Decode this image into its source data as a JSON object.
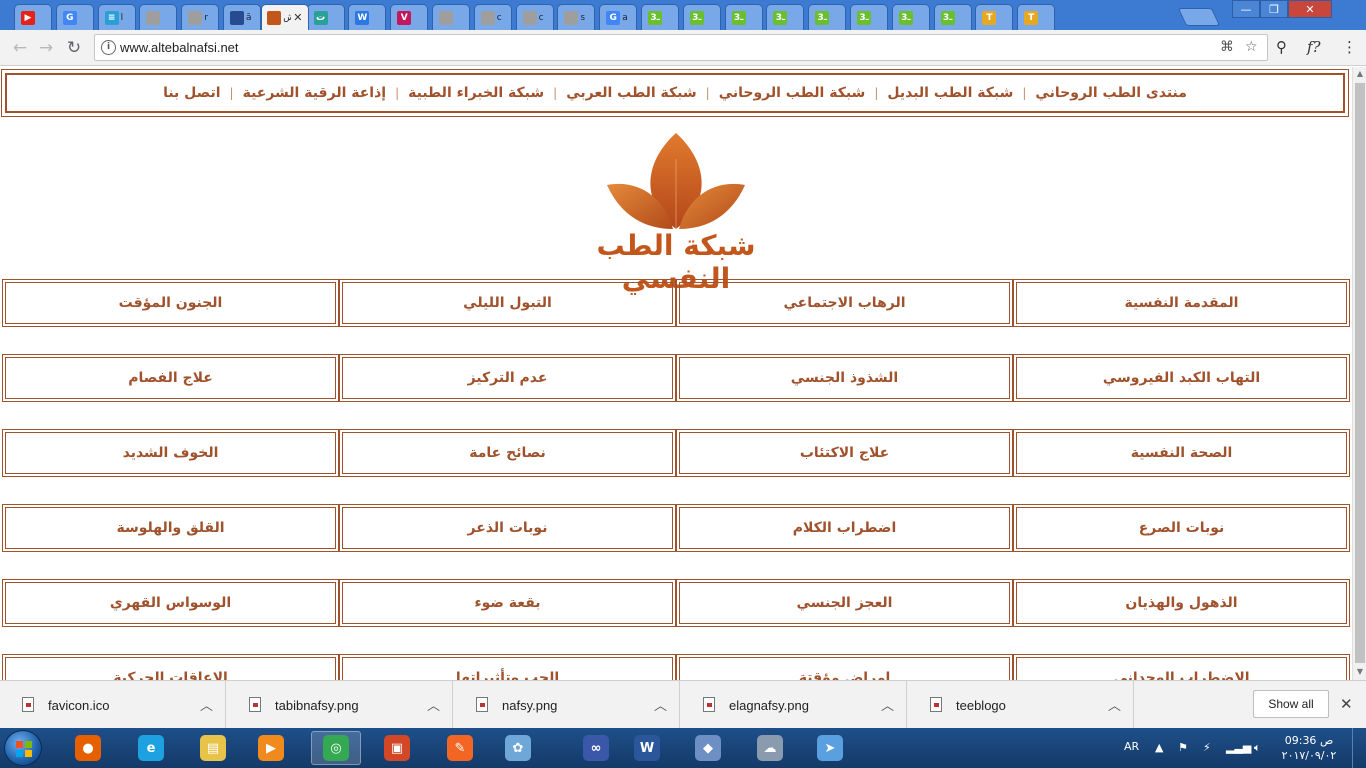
{
  "browser": {
    "tabs": [
      {
        "icon": "youtube-icon",
        "color": "#e62117",
        "glyph": "▶",
        "text": ""
      },
      {
        "icon": "google-icon",
        "color": "#4285f4",
        "glyph": "G",
        "text": ""
      },
      {
        "icon": "site-icon",
        "color": "#2a9fd6",
        "glyph": "≡",
        "text": "أ"
      },
      {
        "icon": "doc-icon",
        "color": "#9e9e9e",
        "glyph": "",
        "text": ""
      },
      {
        "icon": "doc-icon",
        "color": "#9e9e9e",
        "glyph": "",
        "text": "r"
      },
      {
        "icon": "circle-icon",
        "color": "#264b8e",
        "glyph": "",
        "text": "ā"
      },
      {
        "icon": "active-site-icon",
        "color": "#c2561b",
        "glyph": "",
        "text": "ش"
      },
      {
        "icon": "site-icon",
        "color": "#2aa198",
        "glyph": "ت",
        "text": ""
      },
      {
        "icon": "w-icon",
        "color": "#2b78e4",
        "glyph": "W",
        "text": ""
      },
      {
        "icon": "v-icon",
        "color": "#c2185b",
        "glyph": "V",
        "text": ""
      },
      {
        "icon": "doc-icon",
        "color": "#9e9e9e",
        "glyph": "",
        "text": ""
      },
      {
        "icon": "doc-icon",
        "color": "#9e9e9e",
        "glyph": "",
        "text": "c"
      },
      {
        "icon": "doc-icon",
        "color": "#9e9e9e",
        "glyph": "",
        "text": "c"
      },
      {
        "icon": "doc-icon",
        "color": "#9e9e9e",
        "glyph": "",
        "text": "s"
      },
      {
        "icon": "google-icon",
        "color": "#4285f4",
        "glyph": "G",
        "text": "a"
      },
      {
        "icon": "site-icon",
        "color": "#6abf2f",
        "glyph": "ـ3",
        "text": ""
      },
      {
        "icon": "site-icon",
        "color": "#6abf2f",
        "glyph": "ـ3",
        "text": ""
      },
      {
        "icon": "site-icon",
        "color": "#6abf2f",
        "glyph": "ـ3",
        "text": ""
      },
      {
        "icon": "site-icon",
        "color": "#6abf2f",
        "glyph": "ـ3",
        "text": ""
      },
      {
        "icon": "site-icon",
        "color": "#6abf2f",
        "glyph": "ـ3",
        "text": ""
      },
      {
        "icon": "site-icon",
        "color": "#6abf2f",
        "glyph": "ـ3",
        "text": ""
      },
      {
        "icon": "site-icon",
        "color": "#6abf2f",
        "glyph": "ـ3",
        "text": ""
      },
      {
        "icon": "site-icon",
        "color": "#6abf2f",
        "glyph": "ـ3",
        "text": ""
      },
      {
        "icon": "t-icon",
        "color": "#e5a823",
        "glyph": "T",
        "text": ""
      },
      {
        "icon": "t-icon",
        "color": "#e5a823",
        "glyph": "T",
        "text": ""
      }
    ],
    "url": "www.altebalnafsi.net"
  },
  "topnav": {
    "links": [
      "منتدى الطب الروحاني",
      "شبكة الطب البديل",
      "شبكة الطب الروحاني",
      "شبكة الطب العربي",
      "شبكة الخبراء الطبية",
      "إذاعة الرقية الشرعية",
      "اتصل بنا"
    ],
    "separator": "|"
  },
  "logo": {
    "text": "شبكة الطب النفسي",
    "color": "#c2561b"
  },
  "menu": {
    "rows": [
      [
        "المقدمة النفسية",
        "الرهاب الاجتماعي",
        "التبول الليلي",
        "الجنون المؤقت"
      ],
      [
        "التهاب الكبد الفيروسي",
        "الشذوذ الجنسي",
        "عدم التركيز",
        "علاج الفصام"
      ],
      [
        "الصحة النفسية",
        "علاج الاكتئاب",
        "نصائح عامة",
        "الخوف الشديد"
      ],
      [
        "نوبات الصرع",
        "اضطراب الكلام",
        "نوبات الذعر",
        "القلق والهلوسة"
      ],
      [
        "الذهول والهذيان",
        "العجز الجنسي",
        "بقعة ضوء",
        "الوسواس القهري"
      ],
      [
        "الاضطراب الوجداني",
        "امراض مؤقتة",
        "الحب وتأثيراتها",
        "الاعاقات الحركية"
      ]
    ],
    "border_color": "#a0522d"
  },
  "downloads": {
    "items": [
      "favicon.ico",
      "tabibnafsy.png",
      "nafsy.png",
      "elagnafsy.png",
      "teeblogo"
    ],
    "show_all": "Show all"
  },
  "taskbar": {
    "apps": [
      {
        "icon": "firefox-icon",
        "color": "#e66000"
      },
      {
        "icon": "ie-icon",
        "color": "#1ea1e1"
      },
      {
        "icon": "folder-icon",
        "color": "#e8c34a"
      },
      {
        "icon": "media-player-icon",
        "color": "#f08a1c"
      },
      {
        "icon": "chrome-icon",
        "color": "#34a853"
      },
      {
        "icon": "office-icon",
        "color": "#d24726"
      },
      {
        "icon": "pdf-icon",
        "color": "#f26522"
      },
      {
        "icon": "paint-icon",
        "color": "#6ea7d8"
      },
      {
        "icon": "infinity-icon",
        "color": "#3b58a8"
      },
      {
        "icon": "word-icon",
        "color": "#2b579a"
      },
      {
        "icon": "virtualbox-icon",
        "color": "#6d8fc4"
      },
      {
        "icon": "network-icon",
        "color": "#8a9bb0"
      },
      {
        "icon": "send-icon",
        "color": "#5aa0e0"
      }
    ],
    "lang": "AR",
    "time": "09:36 ص",
    "date": "٢٠١٧/٠٩/٠٢"
  }
}
